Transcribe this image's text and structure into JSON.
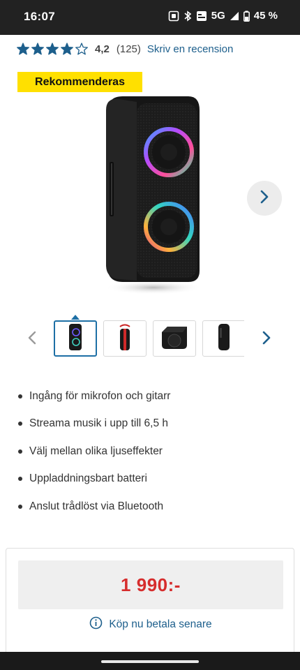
{
  "status_bar": {
    "time": "16:07",
    "network": "5G",
    "battery": "45 %",
    "icons": [
      "screen-record-icon",
      "bluetooth-icon",
      "volte-icon",
      "signal-icon",
      "battery-icon"
    ]
  },
  "rating": {
    "stars": 4,
    "max_stars": 5,
    "value": "4,2",
    "count": "(125)",
    "review_link": "Skriv en recension",
    "star_color": "#1d5f8c"
  },
  "badge": {
    "label": "Rekommenderas",
    "color": "#ffe000"
  },
  "gallery": {
    "product_image": "party-speaker-image",
    "next_icon": "chevron-right-icon",
    "thumbnails": [
      {
        "icon": "speaker-front-thumbnail",
        "active": true
      },
      {
        "icon": "speaker-red-thumbnail",
        "active": false
      },
      {
        "icon": "speaker-top-thumbnail",
        "active": false
      },
      {
        "icon": "speaker-side-thumbnail",
        "active": false
      }
    ]
  },
  "features": [
    "Ingång för mikrofon och gitarr",
    "Streama musik i upp till 6,5 h",
    "Välj mellan olika ljuseffekter",
    "Uppladdningsbart batteri",
    "Anslut trådlöst via Bluetooth"
  ],
  "price": {
    "amount": "1 990:-",
    "color": "#d62d2d",
    "bnpl_label": "Köp nu betala senare",
    "link_color": "#1d5f8c"
  }
}
